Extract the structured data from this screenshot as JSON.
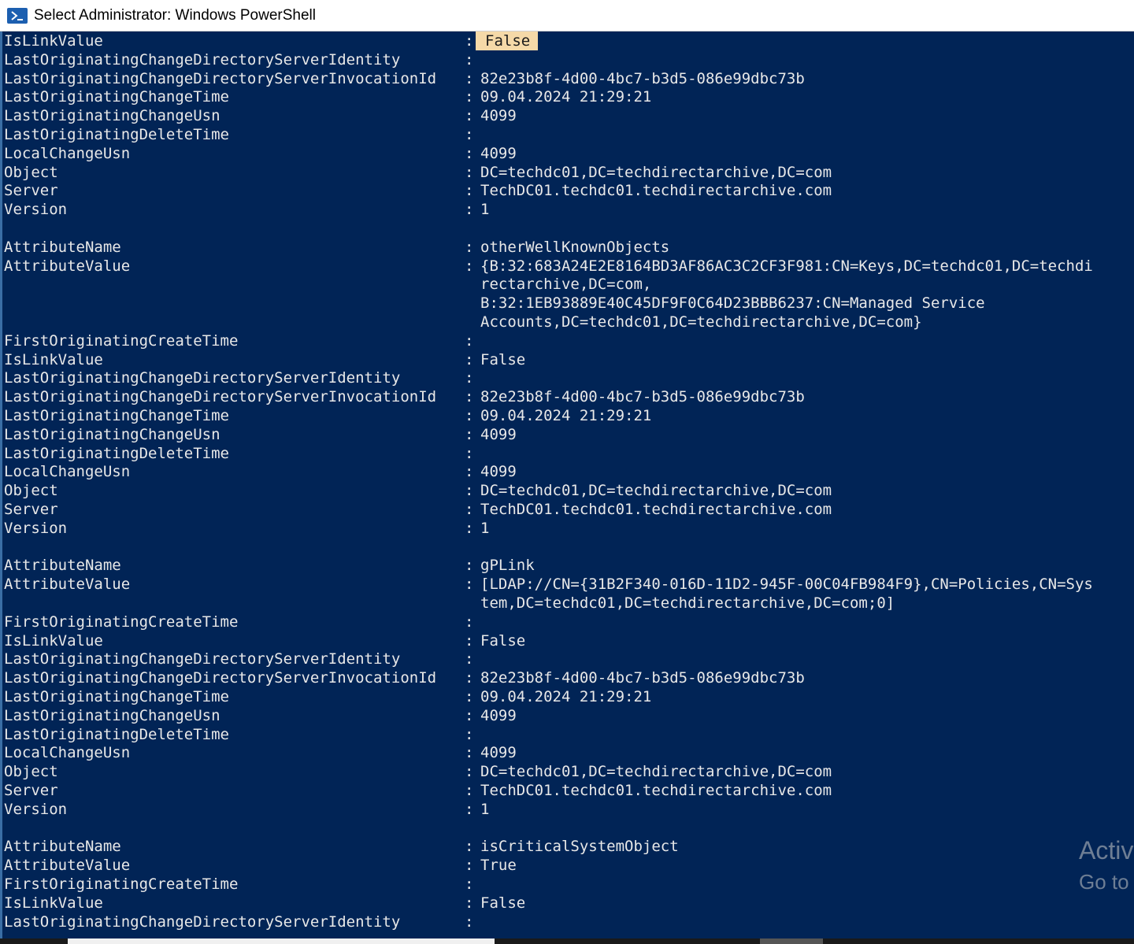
{
  "window": {
    "title": "Select Administrator: Windows PowerShell",
    "icon": "powershell-icon"
  },
  "colors": {
    "console_background": "#012456",
    "console_text": "#e8e8e8",
    "selection_highlight": "#f5d9a8"
  },
  "console": {
    "lines": [
      {
        "key": "IsLinkValue",
        "value": "False",
        "selected": true
      },
      {
        "key": "LastOriginatingChangeDirectoryServerIdentity",
        "value": ""
      },
      {
        "key": "LastOriginatingChangeDirectoryServerInvocationId",
        "value": "82e23b8f-4d00-4bc7-b3d5-086e99dbc73b"
      },
      {
        "key": "LastOriginatingChangeTime",
        "value": "09.04.2024 21:29:21"
      },
      {
        "key": "LastOriginatingChangeUsn",
        "value": "4099"
      },
      {
        "key": "LastOriginatingDeleteTime",
        "value": ""
      },
      {
        "key": "LocalChangeUsn",
        "value": "4099"
      },
      {
        "key": "Object",
        "value": "DC=techdc01,DC=techdirectarchive,DC=com"
      },
      {
        "key": "Server",
        "value": "TechDC01.techdc01.techdirectarchive.com"
      },
      {
        "key": "Version",
        "value": "1"
      },
      {
        "blank": true
      },
      {
        "key": "AttributeName",
        "value": "otherWellKnownObjects"
      },
      {
        "key": "AttributeValue",
        "value": "{B:32:683A24E2E8164BD3AF86AC3C2CF3F981:CN=Keys,DC=techdc01,DC=techdi"
      },
      {
        "continuation": "rectarchive,DC=com,"
      },
      {
        "continuation": "B:32:1EB93889E40C45DF9F0C64D23BBB6237:CN=Managed Service"
      },
      {
        "continuation": "Accounts,DC=techdc01,DC=techdirectarchive,DC=com}"
      },
      {
        "key": "FirstOriginatingCreateTime",
        "value": ""
      },
      {
        "key": "IsLinkValue",
        "value": "False"
      },
      {
        "key": "LastOriginatingChangeDirectoryServerIdentity",
        "value": ""
      },
      {
        "key": "LastOriginatingChangeDirectoryServerInvocationId",
        "value": "82e23b8f-4d00-4bc7-b3d5-086e99dbc73b"
      },
      {
        "key": "LastOriginatingChangeTime",
        "value": "09.04.2024 21:29:21"
      },
      {
        "key": "LastOriginatingChangeUsn",
        "value": "4099"
      },
      {
        "key": "LastOriginatingDeleteTime",
        "value": ""
      },
      {
        "key": "LocalChangeUsn",
        "value": "4099"
      },
      {
        "key": "Object",
        "value": "DC=techdc01,DC=techdirectarchive,DC=com"
      },
      {
        "key": "Server",
        "value": "TechDC01.techdc01.techdirectarchive.com"
      },
      {
        "key": "Version",
        "value": "1"
      },
      {
        "blank": true
      },
      {
        "key": "AttributeName",
        "value": "gPLink"
      },
      {
        "key": "AttributeValue",
        "value": "[LDAP://CN={31B2F340-016D-11D2-945F-00C04FB984F9},CN=Policies,CN=Sys"
      },
      {
        "continuation": "tem,DC=techdc01,DC=techdirectarchive,DC=com;0]"
      },
      {
        "key": "FirstOriginatingCreateTime",
        "value": ""
      },
      {
        "key": "IsLinkValue",
        "value": "False"
      },
      {
        "key": "LastOriginatingChangeDirectoryServerIdentity",
        "value": ""
      },
      {
        "key": "LastOriginatingChangeDirectoryServerInvocationId",
        "value": "82e23b8f-4d00-4bc7-b3d5-086e99dbc73b"
      },
      {
        "key": "LastOriginatingChangeTime",
        "value": "09.04.2024 21:29:21"
      },
      {
        "key": "LastOriginatingChangeUsn",
        "value": "4099"
      },
      {
        "key": "LastOriginatingDeleteTime",
        "value": ""
      },
      {
        "key": "LocalChangeUsn",
        "value": "4099"
      },
      {
        "key": "Object",
        "value": "DC=techdc01,DC=techdirectarchive,DC=com"
      },
      {
        "key": "Server",
        "value": "TechDC01.techdc01.techdirectarchive.com"
      },
      {
        "key": "Version",
        "value": "1"
      },
      {
        "blank": true
      },
      {
        "key": "AttributeName",
        "value": "isCriticalSystemObject"
      },
      {
        "key": "AttributeValue",
        "value": "True"
      },
      {
        "key": "FirstOriginatingCreateTime",
        "value": ""
      },
      {
        "key": "IsLinkValue",
        "value": "False"
      },
      {
        "key": "LastOriginatingChangeDirectoryServerIdentity",
        "value": ""
      }
    ]
  },
  "watermark": {
    "line1": "Activ",
    "line2": "Go to"
  }
}
